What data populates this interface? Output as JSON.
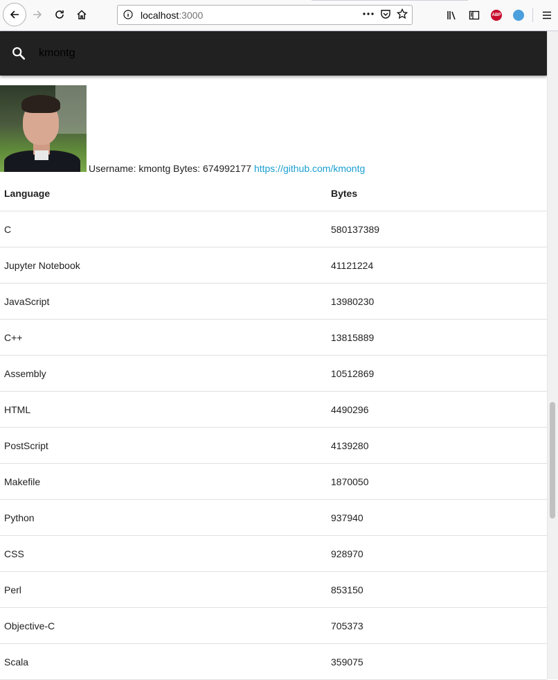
{
  "browser": {
    "url_host": "localhost",
    "url_port": ":3000"
  },
  "search": {
    "value": "kmontg"
  },
  "profile": {
    "username_label": "Username:",
    "username": "kmontg",
    "bytes_label": "Bytes:",
    "bytes": "674992177",
    "link_text": "https://github.com/kmontg"
  },
  "table": {
    "headers": [
      "Language",
      "Bytes"
    ],
    "rows": [
      {
        "language": "C",
        "bytes": "580137389"
      },
      {
        "language": "Jupyter Notebook",
        "bytes": "41121224"
      },
      {
        "language": "JavaScript",
        "bytes": "13980230"
      },
      {
        "language": "C++",
        "bytes": "13815889"
      },
      {
        "language": "Assembly",
        "bytes": "10512869"
      },
      {
        "language": "HTML",
        "bytes": "4490296"
      },
      {
        "language": "PostScript",
        "bytes": "4139280"
      },
      {
        "language": "Makefile",
        "bytes": "1870050"
      },
      {
        "language": "Python",
        "bytes": "937940"
      },
      {
        "language": "CSS",
        "bytes": "928970"
      },
      {
        "language": "Perl",
        "bytes": "853150"
      },
      {
        "language": "Objective-C",
        "bytes": "705373"
      },
      {
        "language": "Scala",
        "bytes": "359075"
      }
    ]
  },
  "colors": {
    "appbar": "#212121",
    "link": "#1a9fd0"
  }
}
